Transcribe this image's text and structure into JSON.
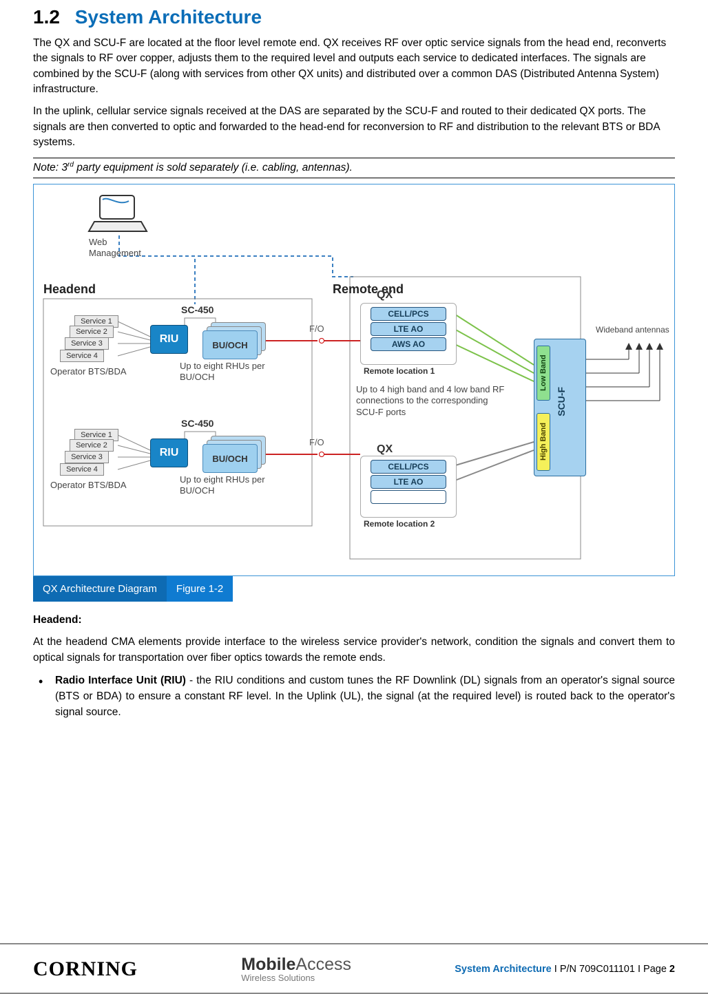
{
  "section": {
    "number": "1.2",
    "title": "System Architecture"
  },
  "p1": "The QX and SCU-F are located at the floor level remote end. QX receives RF over optic service signals from the head end, reconverts the signals to RF over copper, adjusts them to the required level and outputs each service to dedicated interfaces. The signals are combined by the SCU-F (along with services from other QX units) and distributed over a common DAS (Distributed Antenna System) infrastructure.",
  "p2": "In the uplink, cellular service signals received at the DAS are separated by the SCU-F and routed to their dedicated QX ports. The signals are then converted to optic and forwarded to the head-end for reconversion to RF and distribution to the relevant BTS or BDA systems.",
  "note_pre": "Note: 3",
  "note_sup": "rd",
  "note_post": " party equipment is sold separately (i.e. cabling, antennas).",
  "diagram": {
    "web_mgmt": "Web\nManagement",
    "headend": "Headend",
    "remote_end": "Remote end",
    "services": [
      "Service 1",
      "Service 2",
      "Service 3",
      "Service 4"
    ],
    "operator1": "Operator BTS/BDA",
    "operator2": "Operator  BTS/BDA",
    "riu": "RIU",
    "sc450": "SC-450",
    "buoch": "BU/OCH",
    "rhu_note": "Up to eight RHUs per BU/OCH",
    "fo": "F/O",
    "qx": "QX",
    "mods1": [
      "CELL/PCS",
      "LTE AO",
      "AWS AO"
    ],
    "mods2": [
      "CELL/PCS",
      "LTE AO"
    ],
    "loc1": "Remote location 1",
    "loc2": "Remote location 2",
    "conn_note": "Up to 4 high band and 4 low band RF connections to the corresponding SCU-F ports",
    "scuf": "SCU-F",
    "low": "Low Band",
    "high": "High Band",
    "antennas": "Wideband antennas"
  },
  "caption": {
    "left": "QX Architecture Diagram",
    "right": "Figure 1-2"
  },
  "headend_head": "Headend:",
  "headend_para": "At the headend CMA elements provide interface to the wireless service provider's network, condition the signals and convert them to optical signals for transportation over fiber optics towards the remote ends.",
  "riu_label": "Radio Interface Unit (RIU)",
  "riu_text": " - the RIU conditions and custom tunes the RF Downlink (DL) signals from an operator's signal source (BTS or BDA) to ensure a constant RF level. In the Uplink (UL), the signal (at the required level) is routed back to the operator's signal source.",
  "footer": {
    "corning": "CORNING",
    "ma1": "Mobile",
    "ma2": "Access",
    "ma3": "Wireless Solutions",
    "blue": "System Architecture",
    "rest": " I P/N 709C011101 I Page ",
    "page": "2"
  }
}
